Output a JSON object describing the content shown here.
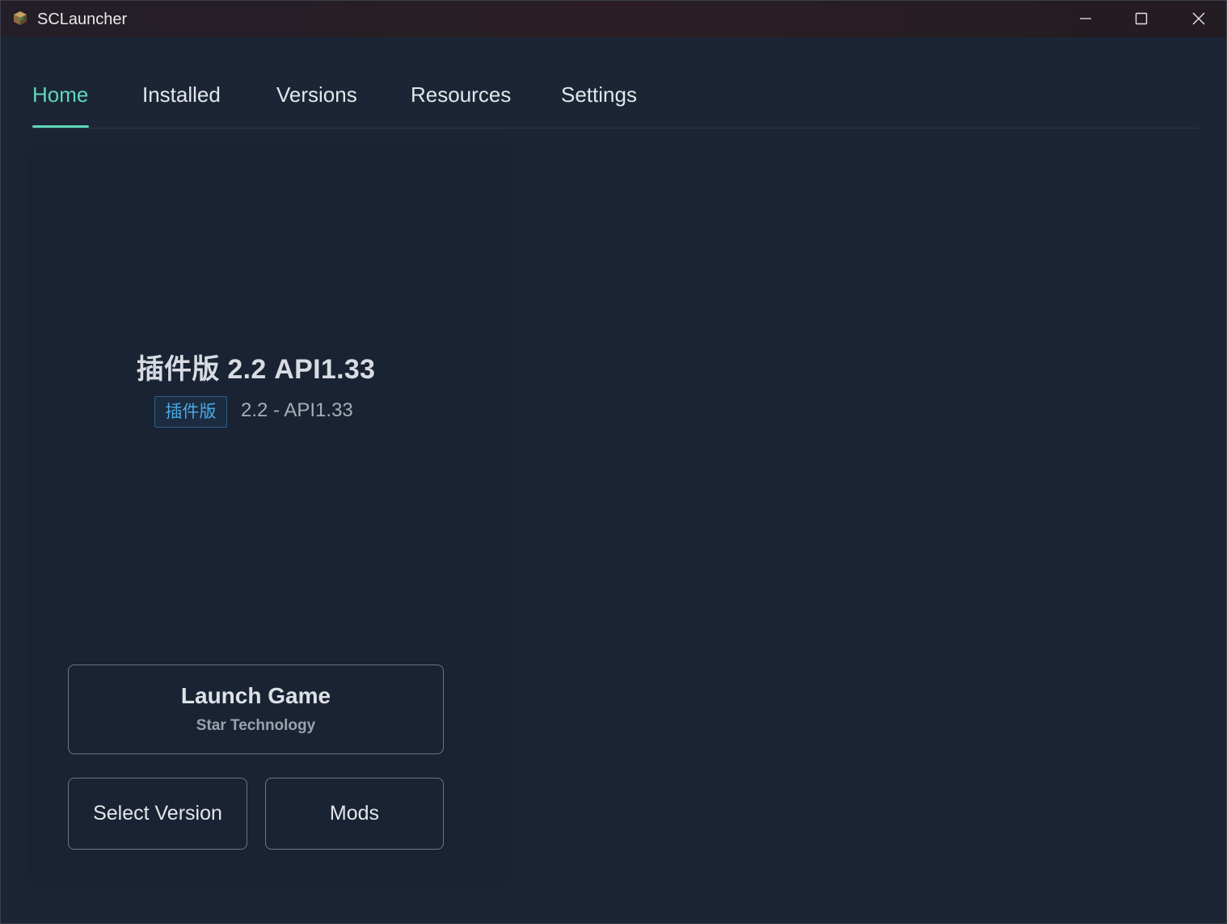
{
  "window": {
    "title": "SCLauncher"
  },
  "tabs": [
    {
      "label": "Home",
      "active": true
    },
    {
      "label": "Installed",
      "active": false
    },
    {
      "label": "Versions",
      "active": false
    },
    {
      "label": "Resources",
      "active": false
    },
    {
      "label": "Settings",
      "active": false
    }
  ],
  "home": {
    "version_title": "插件版 2.2 API1.33",
    "badge": "插件版",
    "version_subtitle": "2.2 - API1.33",
    "launch_label": "Launch Game",
    "launch_sub": "Star Technology",
    "select_version_label": "Select Version",
    "mods_label": "Mods"
  },
  "colors": {
    "accent": "#5fd7b8",
    "background": "#1b2535",
    "badge_text": "#4aa9e6"
  },
  "icons": {
    "app": "cube-icon",
    "minimize": "minimize-icon",
    "maximize": "maximize-icon",
    "close": "close-icon"
  }
}
